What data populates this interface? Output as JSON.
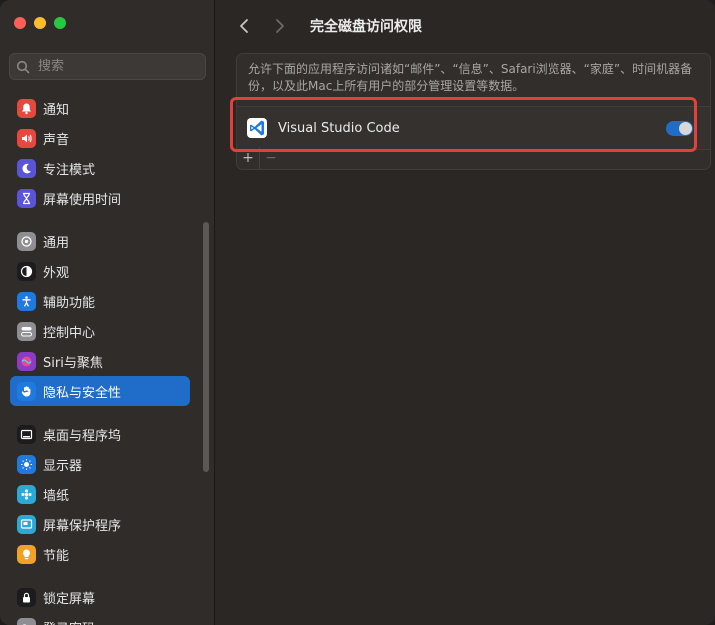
{
  "window": {
    "title": "完全磁盘访问权限"
  },
  "search": {
    "placeholder": "搜索"
  },
  "sidebar": {
    "groups": [
      [
        {
          "label": "通知",
          "icon": "bell-icon",
          "color": "#e5483f"
        },
        {
          "label": "声音",
          "icon": "speaker-icon",
          "color": "#e5483f"
        },
        {
          "label": "专注模式",
          "icon": "moon-icon",
          "color": "#5a55d6"
        },
        {
          "label": "屏幕使用时间",
          "icon": "hourglass-icon",
          "color": "#5a55d6"
        }
      ],
      [
        {
          "label": "通用",
          "icon": "gear-icon",
          "color": "#8e8e93"
        },
        {
          "label": "外观",
          "icon": "appearance-icon",
          "color": "#1c1c1e"
        },
        {
          "label": "辅助功能",
          "icon": "accessibility-icon",
          "color": "#1f7ae0"
        },
        {
          "label": "控制中心",
          "icon": "control-center-icon",
          "color": "#8e8e93"
        },
        {
          "label": "Siri与聚焦",
          "icon": "siri-icon",
          "color": "#8a3cc7"
        },
        {
          "label": "隐私与安全性",
          "icon": "hand-icon",
          "color": "#1f7ae0",
          "selected": true
        }
      ],
      [
        {
          "label": "桌面与程序坞",
          "icon": "dock-icon",
          "color": "#1c1c1e"
        },
        {
          "label": "显示器",
          "icon": "display-icon",
          "color": "#1f7ae0"
        },
        {
          "label": "墙纸",
          "icon": "wallpaper-icon",
          "color": "#2aa9d8"
        },
        {
          "label": "屏幕保护程序",
          "icon": "screensaver-icon",
          "color": "#2aa9d8"
        },
        {
          "label": "节能",
          "icon": "bulb-icon",
          "color": "#f0a126"
        }
      ],
      [
        {
          "label": "锁定屏幕",
          "icon": "lock-icon",
          "color": "#1c1c1e"
        },
        {
          "label": "登录密码",
          "icon": "key-icon",
          "color": "#8e8e93"
        }
      ]
    ]
  },
  "main": {
    "description": "允许下面的应用程序访问诸如“邮件”、“信息”、Safari浏览器、“家庭”、时间机器备份，以及此Mac上所有用户的部分管理设置等数据。",
    "apps": [
      {
        "name": "Visual Studio Code",
        "icon": "vscode-icon",
        "enabled": true
      }
    ],
    "add_label": "+",
    "remove_label": "−"
  },
  "colors": {
    "accent": "#1f6cc9",
    "highlight": "#e2403c"
  }
}
